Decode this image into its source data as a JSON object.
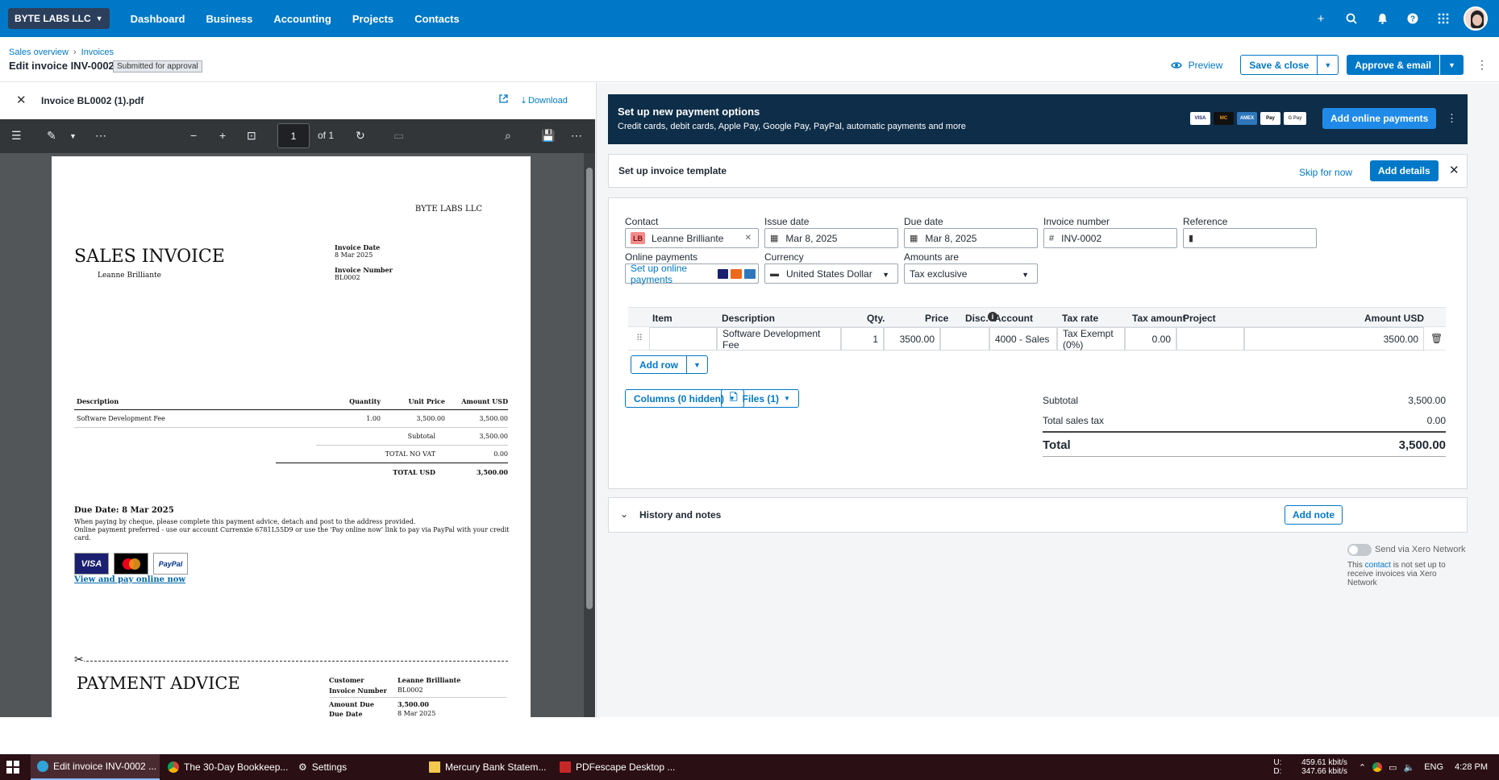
{
  "topnav": {
    "org": "BYTE LABS LLC",
    "items": [
      "Dashboard",
      "Business",
      "Accounting",
      "Projects",
      "Contacts"
    ],
    "icons": [
      "plus-icon",
      "search-icon",
      "bell-icon",
      "help-icon",
      "apps-grid-icon"
    ]
  },
  "header": {
    "breadcrumb": [
      "Sales overview",
      "Invoices"
    ],
    "title": "Edit invoice INV-0002",
    "status": "Submitted for approval",
    "preview": "Preview",
    "save_close": "Save & close",
    "approve_email": "Approve & email"
  },
  "pdf": {
    "filename": "Invoice BL0002 (1).pdf",
    "download": "Download",
    "page": "1",
    "of": "of 1",
    "company": "BYTE LABS LLC",
    "doc_title": "SALES INVOICE",
    "client": "Leanne Brilliante",
    "invoice_date_label": "Invoice Date",
    "invoice_date": "8 Mar 2025",
    "invoice_number_label": "Invoice Number",
    "invoice_number": "BL0002",
    "table_headers": [
      "Description",
      "Quantity",
      "Unit Price",
      "Amount USD"
    ],
    "rows": [
      [
        "Software Development Fee",
        "1.00",
        "3,500.00",
        "3,500.00"
      ]
    ],
    "subtotal_label": "Subtotal",
    "subtotal": "3,500.00",
    "novat_label": "TOTAL NO VAT",
    "novat": "0.00",
    "total_label": "TOTAL USD",
    "total": "3,500.00",
    "due": "Due Date: 8 Mar 2025",
    "instr1": "When paying by cheque, please complete this payment advice, detach and post to the address provided.",
    "instr2": "Online payment preferred - use our account Currenxie 6781L55D9 or use the 'Pay online now' link to pay via PayPal with your credit card.",
    "card_visa": "VISA",
    "card_paypal": "PayPal",
    "pay_link": "View and pay online now",
    "advice_title": "PAYMENT ADVICE",
    "advice": [
      [
        "Customer",
        "Leanne Brilliante"
      ],
      [
        "Invoice Number",
        "BL0002"
      ],
      [
        "Amount Due",
        "3,500.00"
      ],
      [
        "Due Date",
        "8 Mar 2025"
      ]
    ]
  },
  "payment_banner": {
    "title": "Set up new payment options",
    "subtitle": "Credit cards, debit cards, Apple Pay, Google Pay, PayPal, automatic payments and more",
    "cards": [
      "VISA",
      "MC",
      "AMEX",
      "Pay",
      "G Pay"
    ],
    "button": "Add online payments"
  },
  "template_bar": {
    "title": "Set up invoice template",
    "skip": "Skip for now",
    "add": "Add details"
  },
  "form": {
    "contact_label": "Contact",
    "contact_initials": "LB",
    "contact": "Leanne Brilliante",
    "issue_label": "Issue date",
    "issue": "Mar 8, 2025",
    "due_label": "Due date",
    "due": "Mar 8, 2025",
    "number_label": "Invoice number",
    "number": "INV-0002",
    "reference_label": "Reference",
    "reference": "",
    "online_label": "Online payments",
    "online_link": "Set up online payments",
    "currency_label": "Currency",
    "currency": "United States Dollar",
    "amounts_label": "Amounts are",
    "amounts": "Tax exclusive"
  },
  "line_items": {
    "headers": [
      "Item",
      "Description",
      "Qty.",
      "Price",
      "Disc.",
      "Account",
      "Tax rate",
      "Tax amount",
      "Project",
      "Amount USD"
    ],
    "row": {
      "item": "",
      "description": "Software Development Fee",
      "qty": "1",
      "price": "3500.00",
      "disc": "",
      "account": "4000 - Sales",
      "tax_rate": "Tax Exempt (0%)",
      "tax_amount": "0.00",
      "project": "",
      "amount": "3500.00"
    },
    "add_row": "Add row",
    "columns": "Columns (0 hidden)",
    "files": "Files (1)"
  },
  "totals": {
    "subtotal_label": "Subtotal",
    "subtotal": "3,500.00",
    "tax_label": "Total sales tax",
    "tax": "0.00",
    "total_label": "Total",
    "total": "3,500.00"
  },
  "history": {
    "title": "History and notes",
    "add": "Add note"
  },
  "xero_network": {
    "label": "Send via Xero Network",
    "note_pre": "This ",
    "note_link": "contact",
    "note_post": " is not set up to receive invoices via Xero Network"
  },
  "taskbar": {
    "apps": [
      "Edit invoice INV-0002 ...",
      "The 30-Day Bookkeep...",
      "Settings",
      "Mercury Bank Statem...",
      "PDFescape Desktop ..."
    ],
    "net_up": "U:",
    "net_down": "D:",
    "net_up_val": "459.61 kbit/s",
    "net_down_val": "347.66 kbit/s",
    "lang": "ENG",
    "time": "4:28 PM"
  }
}
